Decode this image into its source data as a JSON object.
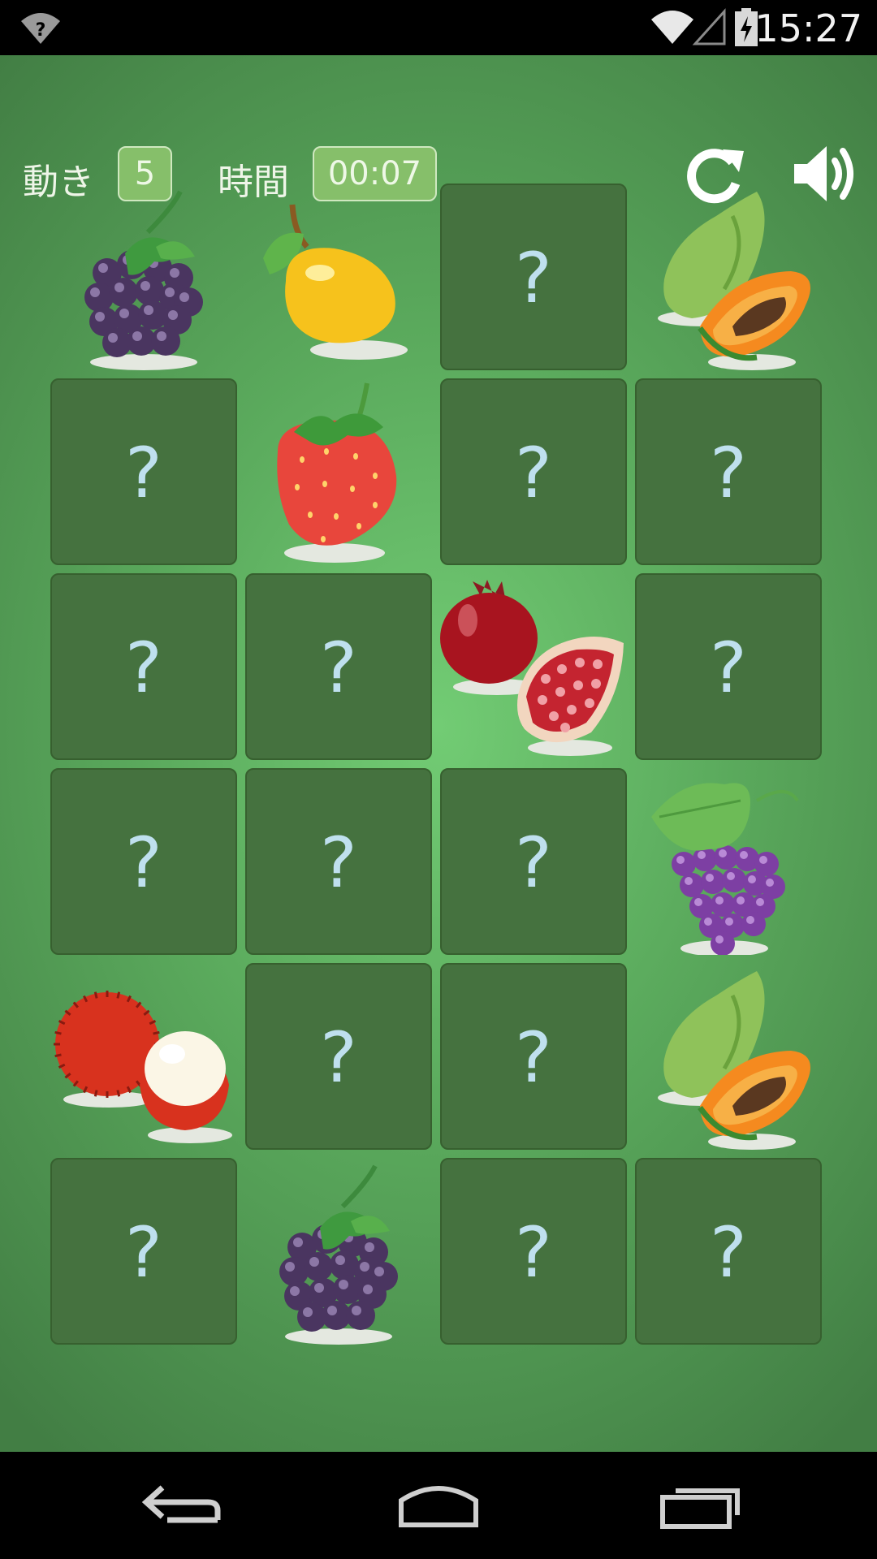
{
  "status_bar": {
    "time": "15:27",
    "icons": [
      "no-sim-icon",
      "wifi-icon",
      "signal-icon",
      "battery-charging-icon"
    ]
  },
  "hud": {
    "moves_label": "動き",
    "moves_value": "5",
    "time_label": "時間",
    "time_value": "00:07",
    "restart_icon": "restart-icon",
    "sound_icon": "sound-icon"
  },
  "board": {
    "rows": 6,
    "cols": 4,
    "hidden_symbol": "?",
    "cells": [
      "blackberry",
      "mango",
      "hidden",
      "papaya",
      "hidden",
      "strawberry",
      "hidden",
      "hidden",
      "hidden",
      "hidden",
      "pomegranate",
      "hidden",
      "hidden",
      "hidden",
      "hidden",
      "grapes",
      "rambutan",
      "hidden",
      "hidden",
      "papaya",
      "hidden",
      "blackberry",
      "hidden",
      "hidden"
    ]
  },
  "nav_bar": {
    "icons": [
      "back-icon",
      "home-icon",
      "recents-icon"
    ]
  }
}
